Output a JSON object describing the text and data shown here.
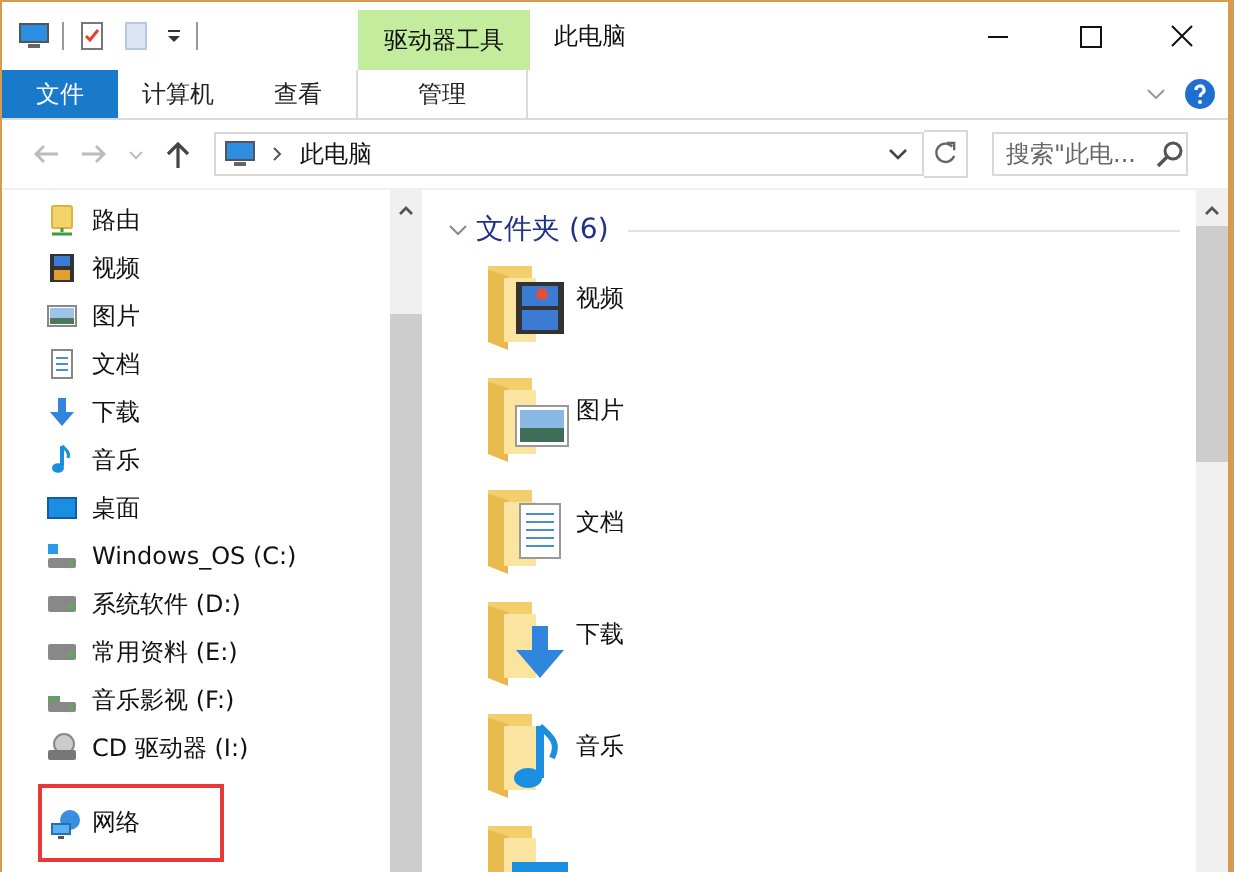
{
  "contextual_group": {
    "label": "驱动器工具"
  },
  "window": {
    "title": "此电脑"
  },
  "ribbon_tabs": [
    {
      "label": "文件",
      "kind": "file"
    },
    {
      "label": "计算机",
      "kind": "normal"
    },
    {
      "label": "查看",
      "kind": "normal"
    },
    {
      "label": "管理",
      "kind": "context"
    }
  ],
  "address_bar": {
    "path": "此电脑",
    "search_placeholder": "搜索\"此电..."
  },
  "nav_pane": {
    "items": [
      {
        "label": "路由",
        "kind": "share",
        "annotated": false
      },
      {
        "label": "视频",
        "kind": "video",
        "annotated": false
      },
      {
        "label": "图片",
        "kind": "picture",
        "annotated": false
      },
      {
        "label": "文档",
        "kind": "document",
        "annotated": false
      },
      {
        "label": "下载",
        "kind": "download",
        "annotated": false
      },
      {
        "label": "音乐",
        "kind": "music",
        "annotated": false
      },
      {
        "label": "桌面",
        "kind": "desktop",
        "annotated": false
      },
      {
        "label": "Windows_OS (C:)",
        "kind": "system-drive",
        "annotated": false
      },
      {
        "label": "系统软件 (D:)",
        "kind": "drive",
        "annotated": false
      },
      {
        "label": "常用资料 (E:)",
        "kind": "drive",
        "annotated": false
      },
      {
        "label": "音乐影视 (F:)",
        "kind": "media-drive",
        "annotated": false
      },
      {
        "label": "CD 驱动器 (I:)",
        "kind": "cd",
        "annotated": false
      },
      {
        "label": "网络",
        "kind": "network",
        "annotated": true
      }
    ]
  },
  "content": {
    "group_title": "文件夹 (6)",
    "expanded": true,
    "folders": [
      {
        "label": "视频",
        "kind": "video"
      },
      {
        "label": "图片",
        "kind": "picture"
      },
      {
        "label": "文档",
        "kind": "document"
      },
      {
        "label": "下载",
        "kind": "download"
      },
      {
        "label": "音乐",
        "kind": "music"
      },
      {
        "kind": "desktop"
      }
    ]
  }
}
